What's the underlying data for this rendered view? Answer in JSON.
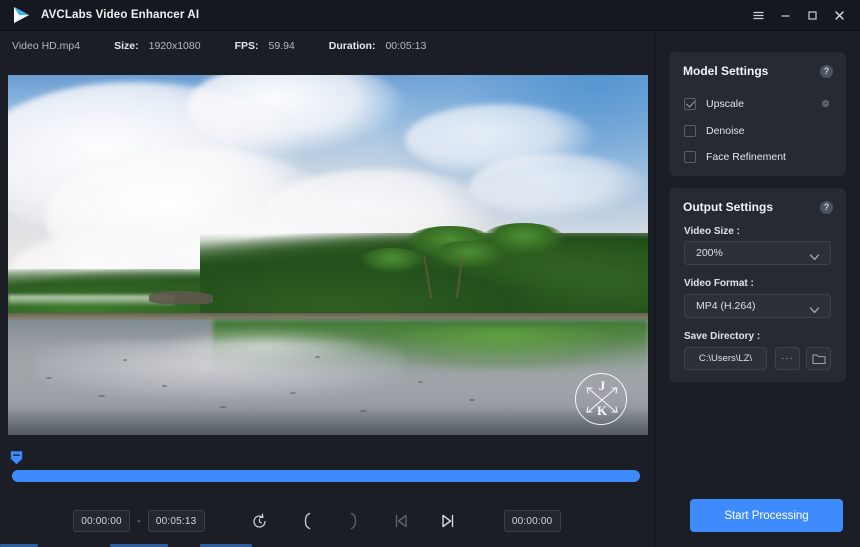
{
  "app": {
    "title": "AVCLabs Video Enhancer AI",
    "logo_icon": "play-triangle-logo",
    "bg_color": "#1b1e25",
    "accent_color": "#3d8bfd"
  },
  "titlebar": {
    "menu_icon": "hamburger-menu-icon",
    "minimize_icon": "minimize-icon",
    "maximize_icon": "maximize-icon",
    "close_icon": "close-icon"
  },
  "fileinfo": {
    "filename": "Video HD.mp4",
    "size_label": "Size:",
    "size_value": "1920x1080",
    "fps_label": "FPS:",
    "fps_value": "59.94",
    "duration_label": "Duration:",
    "duration_value": "00:05:13"
  },
  "preview": {
    "watermark_initial_top": "J",
    "watermark_initial_bottom": "K",
    "watermark_icon": "crossed-arrows-circle-watermark",
    "scene": "tropical-beach-wet-sand-reflection"
  },
  "timeline": {
    "playhead_icon": "playhead-marker-icon",
    "progress_percent": 100,
    "start_time": "00:00:00",
    "separator": "-",
    "end_time": "00:05:13",
    "current_time": "00:00:00",
    "icons": {
      "reset": "reset-clock-icon",
      "mark_in": "bracket-left-icon",
      "mark_out": "bracket-right-icon",
      "prev_frame": "skip-previous-icon",
      "next_frame": "skip-next-icon"
    }
  },
  "model_settings": {
    "title": "Model Settings",
    "help_icon": "help-question-icon",
    "gear_icon": "gear-settings-icon",
    "options": [
      {
        "label": "Upscale",
        "checked": true,
        "has_gear": true
      },
      {
        "label": "Denoise",
        "checked": false,
        "has_gear": false
      },
      {
        "label": "Face Refinement",
        "checked": false,
        "has_gear": false
      }
    ]
  },
  "output_settings": {
    "title": "Output Settings",
    "help_icon": "help-question-icon",
    "video_size_label": "Video Size :",
    "video_size_value": "200%",
    "video_format_label": "Video Format :",
    "video_format_value": "MP4 (H.264)",
    "save_directory_label": "Save Directory :",
    "save_directory_value": "C:\\Users\\LZ\\",
    "browse_label": "···",
    "folder_icon": "folder-open-icon",
    "chevron_icon": "chevron-down-icon"
  },
  "actions": {
    "start_label": "Start Processing"
  }
}
